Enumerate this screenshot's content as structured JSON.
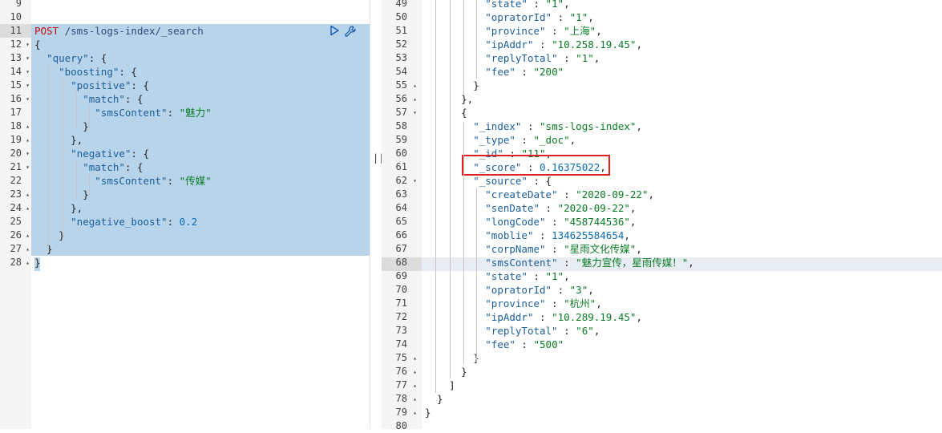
{
  "request": {
    "method": "POST",
    "url": " /sms-logs-index/_search",
    "first_line": 9,
    "lines": [
      {
        "num": "9",
        "text": ""
      },
      {
        "num": "10",
        "text": ""
      },
      {
        "num": "11",
        "text": "POST /sms-logs-index/_search"
      },
      {
        "num": "12",
        "text": "{",
        "fold": "▾"
      },
      {
        "num": "13",
        "text": "  \"query\": {",
        "fold": "▾"
      },
      {
        "num": "14",
        "text": "    \"boosting\": {",
        "fold": "▾"
      },
      {
        "num": "15",
        "text": "      \"positive\": {",
        "fold": "▾"
      },
      {
        "num": "16",
        "text": "        \"match\": {",
        "fold": "▾"
      },
      {
        "num": "17",
        "text": "          \"smsContent\": \"魅力\""
      },
      {
        "num": "18",
        "text": "        }",
        "fold": "▴"
      },
      {
        "num": "19",
        "text": "      },",
        "fold": "▴"
      },
      {
        "num": "20",
        "text": "      \"negative\": {",
        "fold": "▾"
      },
      {
        "num": "21",
        "text": "        \"match\": {",
        "fold": "▾"
      },
      {
        "num": "22",
        "text": "          \"smsContent\": \"传媒\""
      },
      {
        "num": "23",
        "text": "        }",
        "fold": "▴"
      },
      {
        "num": "24",
        "text": "      },",
        "fold": "▴"
      },
      {
        "num": "25",
        "text": "      \"negative_boost\": 0.2"
      },
      {
        "num": "26",
        "text": "    }",
        "fold": "▴"
      },
      {
        "num": "27",
        "text": "  }",
        "fold": "▴"
      },
      {
        "num": "28",
        "text": "}",
        "fold": "▴"
      }
    ]
  },
  "response": {
    "lines": [
      {
        "num": "49",
        "text": "          \"state\" : \"1\","
      },
      {
        "num": "50",
        "text": "          \"opratorId\" : \"1\","
      },
      {
        "num": "51",
        "text": "          \"province\" : \"上海\","
      },
      {
        "num": "52",
        "text": "          \"ipAddr\" : \"10.258.19.45\","
      },
      {
        "num": "53",
        "text": "          \"replyTotal\" : \"1\","
      },
      {
        "num": "54",
        "text": "          \"fee\" : \"200\""
      },
      {
        "num": "55",
        "text": "        }",
        "fold": "▴"
      },
      {
        "num": "56",
        "text": "      },",
        "fold": "▴"
      },
      {
        "num": "57",
        "text": "      {",
        "fold": "▾"
      },
      {
        "num": "58",
        "text": "        \"_index\" : \"sms-logs-index\","
      },
      {
        "num": "59",
        "text": "        \"_type\" : \"_doc\","
      },
      {
        "num": "60",
        "text": "        \"_id\" : \"11\","
      },
      {
        "num": "61",
        "text": "        \"_score\" : 0.16375022,"
      },
      {
        "num": "62",
        "text": "        \"_source\" : {",
        "fold": "▾"
      },
      {
        "num": "63",
        "text": "          \"createDate\" : \"2020-09-22\","
      },
      {
        "num": "64",
        "text": "          \"senDate\" : \"2020-09-22\","
      },
      {
        "num": "65",
        "text": "          \"longCode\" : \"458744536\","
      },
      {
        "num": "66",
        "text": "          \"moblie\" : 134625584654,"
      },
      {
        "num": "67",
        "text": "          \"corpName\" : \"星雨文化传媒\","
      },
      {
        "num": "68",
        "text": "          \"smsContent\" : \"魅力宣传，星雨传媒！\","
      },
      {
        "num": "69",
        "text": "          \"state\" : \"1\","
      },
      {
        "num": "70",
        "text": "          \"opratorId\" : \"3\","
      },
      {
        "num": "71",
        "text": "          \"province\" : \"杭州\","
      },
      {
        "num": "72",
        "text": "          \"ipAddr\" : \"10.289.19.45\","
      },
      {
        "num": "73",
        "text": "          \"replyTotal\" : \"6\","
      },
      {
        "num": "74",
        "text": "          \"fee\" : \"500\""
      },
      {
        "num": "75",
        "text": "        }",
        "fold": "▴"
      },
      {
        "num": "76",
        "text": "      }",
        "fold": "▴"
      },
      {
        "num": "77",
        "text": "    ]",
        "fold": "▴"
      },
      {
        "num": "78",
        "text": "  }",
        "fold": "▴"
      },
      {
        "num": "79",
        "text": "}",
        "fold": "▴"
      },
      {
        "num": "80",
        "text": ""
      }
    ]
  },
  "icons": {
    "run": "play-icon",
    "settings": "wrench-icon",
    "divider": "resize-handle-icon"
  },
  "divider_glyph": "||",
  "colors": {
    "method": "#c5060b",
    "key": "#1b5e9a",
    "string": "#097b24",
    "number": "#0b6bb5",
    "selection": "#b8d4ea",
    "highlight_box": "#e02020"
  }
}
